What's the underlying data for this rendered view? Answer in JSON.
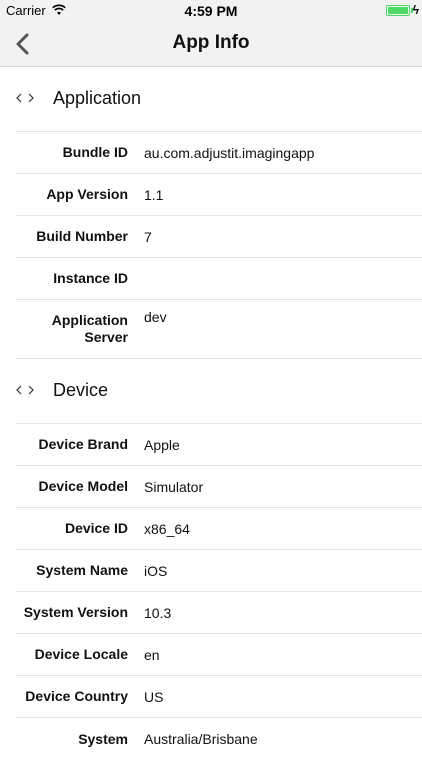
{
  "status_bar": {
    "carrier": "Carrier",
    "time": "4:59 PM",
    "battery_icon": "battery-charging-icon",
    "wifi_icon": "wifi-icon",
    "battery_color": "#4cd964"
  },
  "nav": {
    "title": "App Info",
    "back_icon": "chevron-left-icon"
  },
  "sections": [
    {
      "title": "Application",
      "icon": "code-icon",
      "rows": [
        {
          "label": "Bundle ID",
          "value": "au.com.adjustit.imagingapp"
        },
        {
          "label": "App Version",
          "value": "1.1"
        },
        {
          "label": "Build Number",
          "value": "7"
        },
        {
          "label": "Instance ID",
          "value": ""
        },
        {
          "label": "Application Server",
          "value": "dev"
        }
      ]
    },
    {
      "title": "Device",
      "icon": "code-icon",
      "rows": [
        {
          "label": "Device Brand",
          "value": "Apple"
        },
        {
          "label": "Device Model",
          "value": "Simulator"
        },
        {
          "label": "Device ID",
          "value": "x86_64"
        },
        {
          "label": "System Name",
          "value": "iOS"
        },
        {
          "label": "System Version",
          "value": "10.3"
        },
        {
          "label": "Device Locale",
          "value": "en"
        },
        {
          "label": "Device Country",
          "value": "US"
        },
        {
          "label": "System",
          "value": "Australia/Brisbane"
        }
      ]
    }
  ]
}
